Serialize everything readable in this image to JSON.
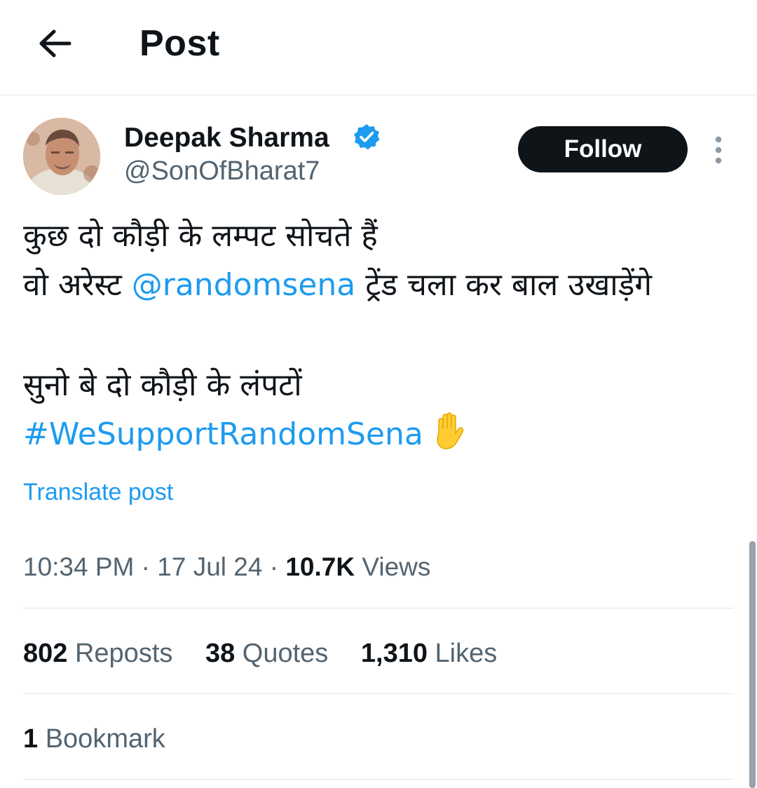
{
  "header": {
    "back_icon": "arrow-left-icon",
    "title": "Post"
  },
  "author": {
    "name": "Deepak Sharma",
    "handle": "@SonOfBharat7",
    "verified_icon": "verified-badge-icon",
    "verified_color": "#1d9bf0",
    "avatar_icon": "profile-photo"
  },
  "actions": {
    "follow_label": "Follow",
    "more_icon": "more-vertical-icon"
  },
  "post": {
    "line1": "कुछ दो कौड़ी के लम्पट सोचते हैं",
    "line2_prefix": "वो अरेस्ट ",
    "mention": "@randomsena",
    "line2_suffix": " ट्रेंड चला कर बाल उखाड़ेंगे",
    "line3": "सुनो बे दो कौड़ी के लंपटों",
    "hashtag": "#WeSupportRandomSena",
    "emoji_icon": "raised-hand-icon",
    "translate_label": "Translate post"
  },
  "meta": {
    "time": "10:34 PM",
    "sep": " · ",
    "date": "17 Jul 24",
    "views_count": "10.7K",
    "views_label": "Views"
  },
  "stats": {
    "reposts_count": "802",
    "reposts_label": "Reposts",
    "quotes_count": "38",
    "quotes_label": "Quotes",
    "likes_count": "1,310",
    "likes_label": "Likes"
  },
  "bookmarks": {
    "count": "1",
    "label": "Bookmark"
  },
  "colors": {
    "accent": "#1d9bf0",
    "text": "#0f1419",
    "secondary": "#536471",
    "follow_bg": "#0f1419"
  }
}
